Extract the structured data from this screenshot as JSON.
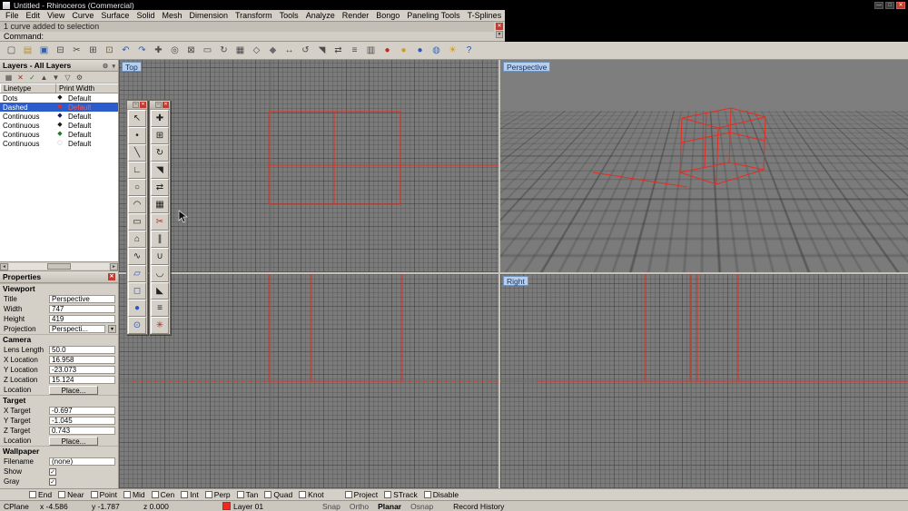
{
  "window": {
    "title": "Untitled - Rhinoceros (Commercial)",
    "controls": {
      "minimize": "—",
      "maximize": "□",
      "close": "✕"
    }
  },
  "menu": {
    "items": [
      "File",
      "Edit",
      "View",
      "Curve",
      "Surface",
      "Solid",
      "Mesh",
      "Dimension",
      "Transform",
      "Tools",
      "Analyze",
      "Render",
      "Bongo",
      "Paneling Tools",
      "T-Splines",
      "V-Ray",
      "Help"
    ]
  },
  "command": {
    "history": "1 curve added to selection",
    "prompt": "Command:"
  },
  "main_toolbar": {
    "icons": [
      {
        "name": "new-file",
        "glyph": "▢",
        "color": "#4a4a4a"
      },
      {
        "name": "open-file",
        "glyph": "▤",
        "color": "#b98e2f"
      },
      {
        "name": "save",
        "glyph": "▣",
        "color": "#2f5fae"
      },
      {
        "name": "print",
        "glyph": "⊟",
        "color": "#4a4a4a"
      },
      {
        "name": "cut",
        "glyph": "✂",
        "color": "#4a4a4a"
      },
      {
        "name": "copy-clipboard",
        "glyph": "⊞",
        "color": "#4a4a4a"
      },
      {
        "name": "paste",
        "glyph": "⊡",
        "color": "#7a5c2e"
      },
      {
        "name": "undo",
        "glyph": "↶",
        "color": "#2f5fae"
      },
      {
        "name": "redo",
        "glyph": "↷",
        "color": "#2f5fae"
      },
      {
        "name": "pan",
        "glyph": "✚",
        "color": "#4a4a4a"
      },
      {
        "name": "zoom-dynamic",
        "glyph": "◎",
        "color": "#4a4a4a"
      },
      {
        "name": "zoom-window",
        "glyph": "⊠",
        "color": "#4a4a4a"
      },
      {
        "name": "zoom-extents",
        "glyph": "▭",
        "color": "#4a4a4a"
      },
      {
        "name": "rotate-view",
        "glyph": "↻",
        "color": "#4a4a4a"
      },
      {
        "name": "named-views",
        "glyph": "▦",
        "color": "#4a4a4a"
      },
      {
        "name": "wireframe-display",
        "glyph": "◇",
        "color": "#4a4a4a"
      },
      {
        "name": "shaded-display",
        "glyph": "◆",
        "color": "#6a6a6a"
      },
      {
        "name": "move",
        "glyph": "↔",
        "color": "#4a4a4a"
      },
      {
        "name": "rotate",
        "glyph": "↺",
        "color": "#4a4a4a"
      },
      {
        "name": "scale",
        "glyph": "◥",
        "color": "#4a4a4a"
      },
      {
        "name": "mirror",
        "glyph": "⇄",
        "color": "#4a4a4a"
      },
      {
        "name": "layers-dialog",
        "glyph": "≡",
        "color": "#4a4a4a"
      },
      {
        "name": "object-properties",
        "glyph": "▥",
        "color": "#4a4a4a"
      },
      {
        "name": "render-sphere-red",
        "glyph": "●",
        "color": "#c4281c"
      },
      {
        "name": "render-sphere-yellow",
        "glyph": "●",
        "color": "#d29a1f"
      },
      {
        "name": "render-sphere-blue",
        "glyph": "●",
        "color": "#2b57c0"
      },
      {
        "name": "earth-globe",
        "glyph": "◍",
        "color": "#3a6abf"
      },
      {
        "name": "sun",
        "glyph": "☀",
        "color": "#d29a1f"
      },
      {
        "name": "help",
        "glyph": "?",
        "color": "#1a50c8"
      }
    ]
  },
  "layers_panel": {
    "title": "Layers - All Layers",
    "tools": [
      {
        "name": "new-layer",
        "glyph": "▦",
        "color": "#4a4a4a"
      },
      {
        "name": "delete-layer",
        "glyph": "✕",
        "color": "#b02a1e"
      },
      {
        "name": "match-layer",
        "glyph": "✓",
        "color": "#2a7a2a"
      },
      {
        "name": "move-up",
        "glyph": "▲",
        "color": "#4a4a4a"
      },
      {
        "name": "move-down",
        "glyph": "▼",
        "color": "#4a4a4a"
      },
      {
        "name": "filter",
        "glyph": "▽",
        "color": "#4a4a4a"
      },
      {
        "name": "layer-tools",
        "glyph": "⚙",
        "color": "#4a4a4a"
      }
    ],
    "columns": [
      "Linetype",
      "Print Width"
    ],
    "rows": [
      {
        "linetype": "Dots",
        "print_width": "Default",
        "color": "#1a1a1a",
        "selected": false
      },
      {
        "linetype": "Dashed",
        "print_width": "Default",
        "color": "#ea2b1d",
        "selected": true
      },
      {
        "linetype": "Continuous",
        "print_width": "Default",
        "color": "#16166b",
        "selected": false
      },
      {
        "linetype": "Continuous",
        "print_width": "Default",
        "color": "#1a1a1a",
        "selected": false
      },
      {
        "linetype": "Continuous",
        "print_width": "Default",
        "color": "#1f7a1f",
        "selected": false
      },
      {
        "linetype": "Continuous",
        "print_width": "Default",
        "color": "#ffffff",
        "selected": false
      }
    ]
  },
  "properties_panel": {
    "title": "Properties",
    "sections": [
      {
        "title": "Viewport",
        "rows": [
          {
            "label": "Title",
            "value": "Perspective",
            "type": "field"
          },
          {
            "label": "Width",
            "value": "747",
            "type": "field"
          },
          {
            "label": "Height",
            "value": "419",
            "type": "field"
          },
          {
            "label": "Projection",
            "value": "Perspecti...",
            "type": "dropdown"
          }
        ]
      },
      {
        "title": "Camera",
        "rows": [
          {
            "label": "Lens Length",
            "value": "50.0",
            "type": "field"
          },
          {
            "label": "X Location",
            "value": "16.958",
            "type": "field"
          },
          {
            "label": "Y Location",
            "value": "-23.073",
            "type": "field"
          },
          {
            "label": "Z Location",
            "value": "15.124",
            "type": "field"
          },
          {
            "label": "Location",
            "value": "Place...",
            "type": "button"
          }
        ]
      },
      {
        "title": "Target",
        "rows": [
          {
            "label": "X Target",
            "value": "-0.697",
            "type": "field"
          },
          {
            "label": "Y Target",
            "value": "-1.045",
            "type": "field"
          },
          {
            "label": "Z Target",
            "value": "0.743",
            "type": "field"
          },
          {
            "label": "Location",
            "value": "Place...",
            "type": "button"
          }
        ]
      },
      {
        "title": "Wallpaper",
        "rows": [
          {
            "label": "Filename",
            "value": "(none)",
            "type": "field"
          },
          {
            "label": "Show",
            "value": "checked",
            "type": "checkbox"
          },
          {
            "label": "Gray",
            "value": "checked",
            "type": "checkbox"
          }
        ]
      }
    ]
  },
  "palettes": {
    "main1": {
      "icons": [
        {
          "name": "select",
          "glyph": "↖",
          "color": "#222222"
        },
        {
          "name": "point",
          "glyph": "•",
          "color": "#222222"
        },
        {
          "name": "line",
          "glyph": "╲",
          "color": "#222222"
        },
        {
          "name": "polyline",
          "glyph": "∟",
          "color": "#222222"
        },
        {
          "name": "circle",
          "glyph": "○",
          "color": "#222222"
        },
        {
          "name": "arc",
          "glyph": "◠",
          "color": "#222222"
        },
        {
          "name": "rectangle",
          "glyph": "▭",
          "color": "#222222"
        },
        {
          "name": "polygon",
          "glyph": "⌂",
          "color": "#222222"
        },
        {
          "name": "curve",
          "glyph": "∿",
          "color": "#222222"
        },
        {
          "name": "surface",
          "glyph": "▱",
          "color": "#2b57c0"
        },
        {
          "name": "box",
          "glyph": "◻",
          "color": "#2b57c0"
        },
        {
          "name": "sphere",
          "glyph": "●",
          "color": "#2b57c0"
        },
        {
          "name": "cylinder",
          "glyph": "⊙",
          "color": "#2b57c0"
        }
      ]
    },
    "main2": {
      "icons": [
        {
          "name": "move",
          "glyph": "✚",
          "color": "#222222"
        },
        {
          "name": "copy",
          "glyph": "⊞",
          "color": "#222222"
        },
        {
          "name": "rotate",
          "glyph": "↻",
          "color": "#222222"
        },
        {
          "name": "scale",
          "glyph": "◥",
          "color": "#222222"
        },
        {
          "name": "mirror",
          "glyph": "⇄",
          "color": "#222222"
        },
        {
          "name": "array",
          "glyph": "▦",
          "color": "#222222"
        },
        {
          "name": "trim",
          "glyph": "✂",
          "color": "#b02a1e"
        },
        {
          "name": "split",
          "glyph": "∥",
          "color": "#222222"
        },
        {
          "name": "join",
          "glyph": "∪",
          "color": "#222222"
        },
        {
          "name": "fillet",
          "glyph": "◡",
          "color": "#222222"
        },
        {
          "name": "chamfer",
          "glyph": "◣",
          "color": "#222222"
        },
        {
          "name": "offset",
          "glyph": "≡",
          "color": "#222222"
        },
        {
          "name": "explode",
          "glyph": "✳",
          "color": "#b02a1e"
        }
      ]
    }
  },
  "viewports": {
    "top_label": "Top",
    "perspective_label": "Perspective",
    "right_label": "Right"
  },
  "osnap_bar": {
    "items": [
      "End",
      "Near",
      "Point",
      "Mid",
      "Cen",
      "Int",
      "Perp",
      "Tan",
      "Quad",
      "Knot"
    ],
    "extras": [
      "Project",
      "STrack",
      "Disable"
    ]
  },
  "status_bar": {
    "cplane": "CPlane",
    "coord_x": "x -4.586",
    "coord_y": "y -1.787",
    "coord_z": "z 0.000",
    "layer": "Layer 01",
    "layer_color": "#ea2b1d",
    "toggles": [
      {
        "label": "Snap",
        "active": false
      },
      {
        "label": "Ortho",
        "active": false
      },
      {
        "label": "Planar",
        "active": true
      },
      {
        "label": "Osnap",
        "active": false
      }
    ],
    "record_history": "Record History"
  }
}
